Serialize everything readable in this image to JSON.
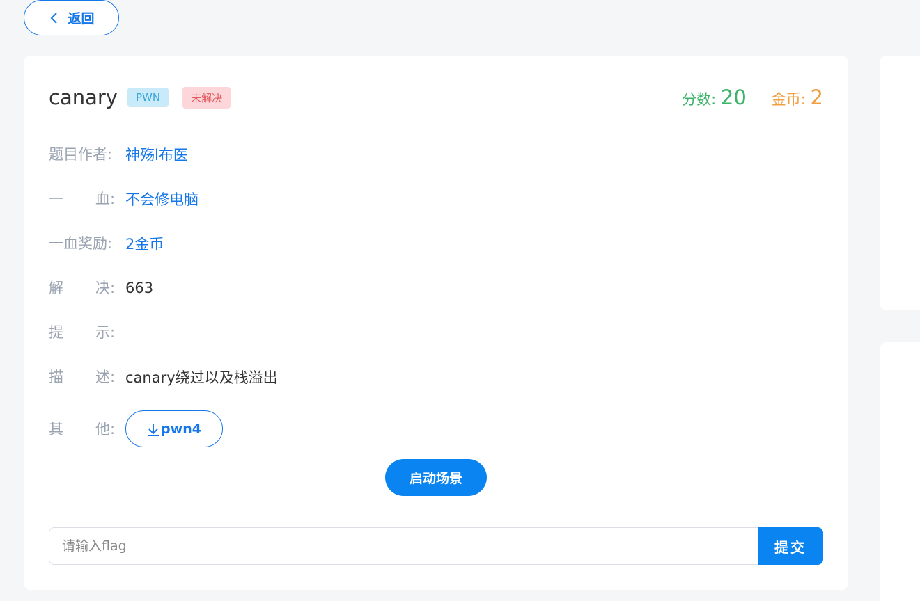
{
  "back": {
    "label": "返回"
  },
  "challenge": {
    "title": "canary",
    "category": "PWN",
    "status": "未解决",
    "score_label": "分数:",
    "score": "20",
    "coin_label": "金币:",
    "coin": "2"
  },
  "info": {
    "author": {
      "label": "题目作者:",
      "value": "神殇l布医"
    },
    "first_blood": {
      "label_a": "一",
      "label_b": "血:",
      "value": "不会修电脑"
    },
    "first_blood_reward": {
      "label": "一血奖励:",
      "value": "2金币"
    },
    "solves": {
      "label_a": "解",
      "label_b": "决:",
      "value": "663"
    },
    "hint": {
      "label_a": "提",
      "label_b": "示:",
      "value": ""
    },
    "description": {
      "label_a": "描",
      "label_b": "述:",
      "value": "canary绕过以及栈溢出"
    },
    "other": {
      "label_a": "其",
      "label_b": "他:",
      "download_label": "pwn4"
    }
  },
  "launch": {
    "label": "启动场景"
  },
  "flag": {
    "placeholder": "请输入flag",
    "value": "",
    "submit_label": "提交"
  },
  "colors": {
    "accent": "#0a84f0",
    "link": "#1677e8",
    "score": "#3cb56a",
    "coin": "#f0a040",
    "tag_cat_bg": "#c9ebf9",
    "tag_status_bg": "#fcd6d8"
  }
}
